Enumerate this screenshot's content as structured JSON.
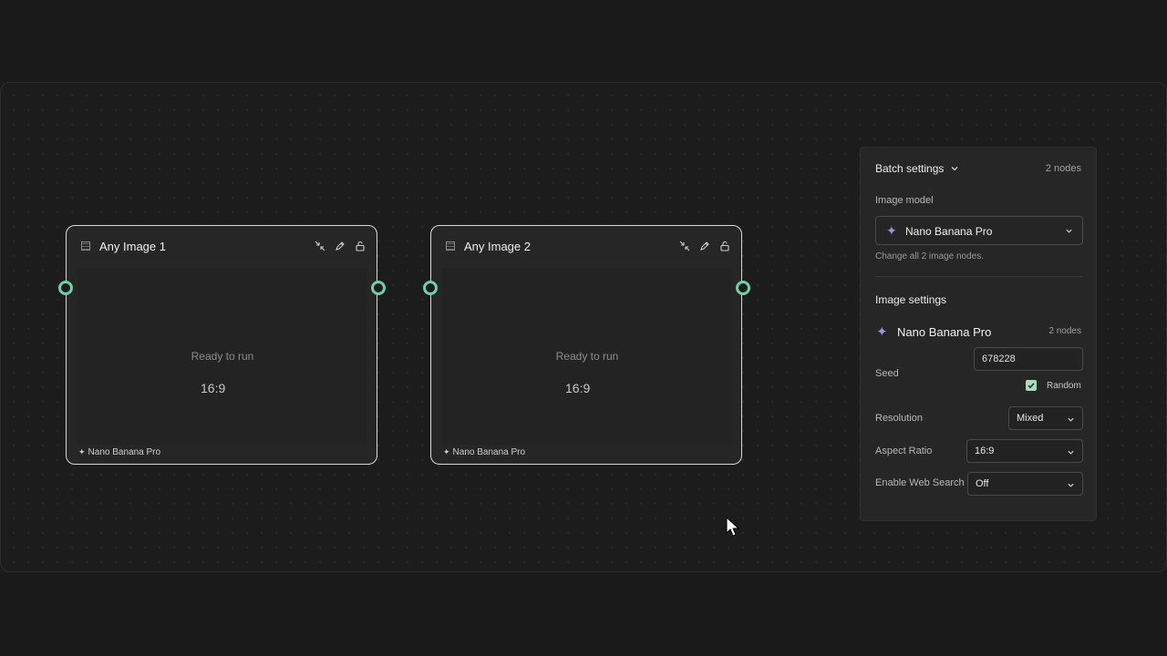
{
  "canvas": {
    "nodes": [
      {
        "title": "Any Image 1",
        "status": "Ready to run",
        "ratio": "16:9",
        "model": "Nano Banana Pro"
      },
      {
        "title": "Any Image 2",
        "status": "Ready to run",
        "ratio": "16:9",
        "model": "Nano Banana Pro"
      }
    ]
  },
  "panel": {
    "title": "Batch settings",
    "count": "2 nodes",
    "image_model_label": "Image model",
    "image_model_value": "Nano Banana Pro",
    "image_model_hint": "Change all 2 image nodes.",
    "image_settings_title": "Image settings",
    "model_name": "Nano Banana Pro",
    "model_count": "2 nodes",
    "seed_label": "Seed",
    "seed_value": "678228",
    "random_label": "Random",
    "random_checked": true,
    "resolution_label": "Resolution",
    "resolution_value": "Mixed",
    "aspect_label": "Aspect Ratio",
    "aspect_value": "16:9",
    "web_search_label": "Enable Web Search",
    "web_search_value": "Off"
  },
  "colors": {
    "port": "#6fd0a6",
    "accent_sparkle": "#9d8ee0",
    "checkbox": "#a8dcc0"
  },
  "icons": [
    "image-node-icon",
    "collapse-icon",
    "edit-icon",
    "unlock-icon",
    "chevron-down-icon",
    "sparkle-icon",
    "checkmark-icon",
    "cursor-icon"
  ]
}
